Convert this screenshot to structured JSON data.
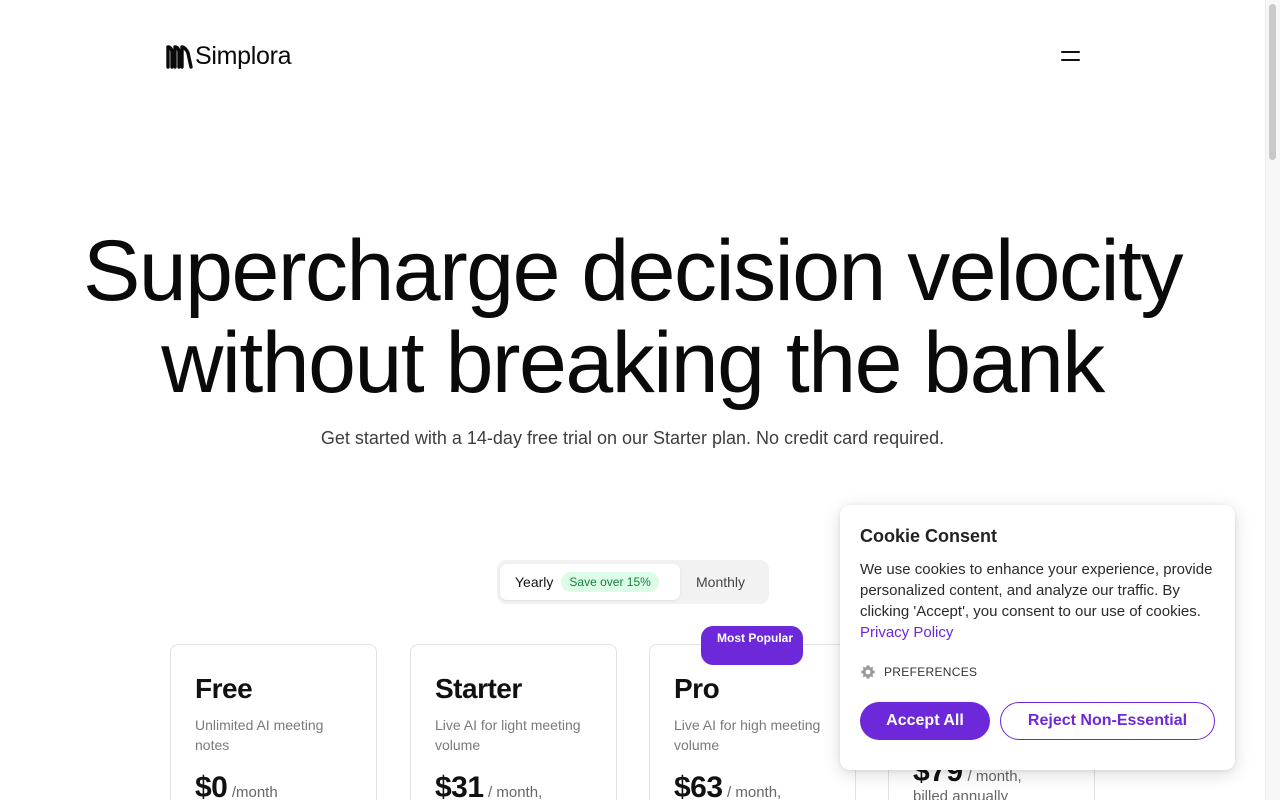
{
  "header": {
    "logo_text": "Simplora",
    "logo_icon": "simplora-logo-mark",
    "menu_icon": "hamburger-menu-icon"
  },
  "hero": {
    "title_line1": "Supercharge decision velocity",
    "title_line2": "without breaking the bank",
    "subtitle": "Get started with a 14-day free trial on our Starter plan. No credit card required."
  },
  "billing_toggle": {
    "yearly_label": "Yearly",
    "save_badge": "Save over 15%",
    "monthly_label": "Monthly",
    "selected": "Yearly"
  },
  "plans": [
    {
      "name": "Free",
      "description": "Unlimited AI meeting notes",
      "price": "$0",
      "period": "/month"
    },
    {
      "name": "Starter",
      "description": "Live AI for light meeting volume",
      "price": "$31",
      "period": "/ month,"
    },
    {
      "name": "Pro",
      "description": "Live AI for high meeting volume",
      "price": "$63",
      "period": "/ month,",
      "badge": "Most Popular"
    },
    {
      "price": "$79",
      "period": "/ month,",
      "billing_note": "billed annually"
    }
  ],
  "cookie_consent": {
    "title": "Cookie Consent",
    "body": "We use cookies to enhance your experience, provide personalized content, and analyze our traffic. By clicking 'Accept', you consent to our use of cookies.",
    "link_text": "Privacy Policy",
    "preferences_label": "PREFERENCES",
    "accept_label": "Accept All",
    "reject_label": "Reject Non-Essential"
  },
  "colors": {
    "accent": "#6d28d9",
    "save_badge_text": "#15803d",
    "save_badge_bg": "#dcfce7"
  }
}
